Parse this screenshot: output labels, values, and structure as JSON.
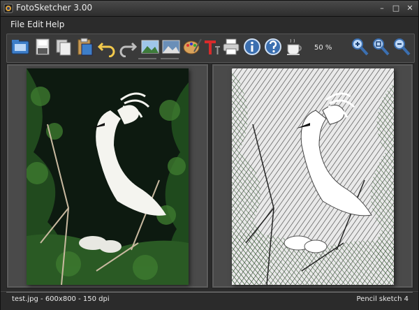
{
  "window": {
    "title": "FotoSketcher 3.00"
  },
  "menu": {
    "items": [
      "File",
      "Edit",
      "Help"
    ]
  },
  "toolbar": {
    "zoom": "50 %"
  },
  "status": {
    "left": "test.jpg - 600x800 - 150 dpi",
    "right": "Pencil sketch 4"
  },
  "colors": {
    "accent": "#3b6fb0",
    "background": "#2b2b2b"
  }
}
